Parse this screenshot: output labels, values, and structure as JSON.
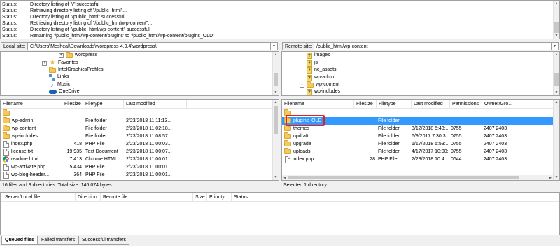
{
  "log": [
    {
      "label": "Status:",
      "text": "Directory listing of \"/\" successful"
    },
    {
      "label": "Status:",
      "text": "Retrieving directory listing of \"/public_html\"..."
    },
    {
      "label": "Status:",
      "text": "Directory listing of \"/public_html\" successful"
    },
    {
      "label": "Status:",
      "text": "Retrieving directory listing of \"/public_html/wp-content\"..."
    },
    {
      "label": "Status:",
      "text": "Directory listing of \"/public_html/wp-content\" successful"
    },
    {
      "label": "Status:",
      "text": "Renaming '/public_html/wp-content/plugins' to '/public_html/wp-content/plugins_OLD'"
    }
  ],
  "local_site": {
    "label": "Local site:",
    "path": "C:\\Users\\Mesheal\\Downloads\\wordpress-4.9.4\\wordpress\\",
    "tree": [
      {
        "label": "wordpress",
        "icon": "folder-icon",
        "expander": "+"
      },
      {
        "label": "Favorites",
        "icon": "star-icon",
        "expander": "+"
      },
      {
        "label": "IntelGraphicsProfiles",
        "icon": "folder-icon",
        "expander": ""
      },
      {
        "label": "Links",
        "icon": "link-icon",
        "expander": ""
      },
      {
        "label": "Music",
        "icon": "music-icon",
        "expander": ""
      },
      {
        "label": "OneDrive",
        "icon": "cloud-icon",
        "expander": ""
      }
    ],
    "columns": {
      "filename": "Filename",
      "filesize": "Filesize",
      "filetype": "Filetype",
      "modified": "Last modified"
    },
    "files": [
      {
        "name": "..",
        "size": "",
        "type": "",
        "modified": "",
        "icon": "folder-icon"
      },
      {
        "name": "wp-admin",
        "size": "",
        "type": "File folder",
        "modified": "2/23/2018 11:11:13...",
        "icon": "folder-icon"
      },
      {
        "name": "wp-content",
        "size": "",
        "type": "File folder",
        "modified": "2/23/2018 11:02:18...",
        "icon": "folder-icon"
      },
      {
        "name": "wp-includes",
        "size": "",
        "type": "File folder",
        "modified": "2/23/2018 11:08:57...",
        "icon": "folder-icon"
      },
      {
        "name": "index.php",
        "size": "418",
        "type": "PHP File",
        "modified": "2/23/2018 11:00:03...",
        "icon": "file-icon"
      },
      {
        "name": "license.txt",
        "size": "19,935",
        "type": "Text Document",
        "modified": "2/23/2018 11:00:07...",
        "icon": "file-icon"
      },
      {
        "name": "readme.html",
        "size": "7,413",
        "type": "Chrome HTML...",
        "modified": "2/23/2018 11:00:01...",
        "icon": "chrome-icon"
      },
      {
        "name": "wp-activate.php",
        "size": "5,434",
        "type": "PHP File",
        "modified": "2/23/2018 11:00:01...",
        "icon": "file-icon"
      },
      {
        "name": "wp-blog-header...",
        "size": "364",
        "type": "PHP File",
        "modified": "2/23/2018 11:00:01...",
        "icon": "file-icon"
      }
    ],
    "status": "16 files and 3 directories. Total size: 146,074 bytes"
  },
  "remote_site": {
    "label": "Remote site:",
    "path": "/public_html/wp-content",
    "tree": [
      {
        "label": "images",
        "icon": "question-icon",
        "expander": ""
      },
      {
        "label": "js",
        "icon": "question-icon",
        "expander": ""
      },
      {
        "label": "nc_assets",
        "icon": "question-icon",
        "expander": ""
      },
      {
        "label": "wp-admin",
        "icon": "question-icon",
        "expander": ""
      },
      {
        "label": "wp-content",
        "icon": "folder-icon",
        "expander": "-"
      },
      {
        "label": "wp-includes",
        "icon": "question-icon",
        "expander": ""
      }
    ],
    "columns": {
      "filename": "Filename",
      "filesize": "Filesize",
      "filetype": "Filetype",
      "modified": "Last modified",
      "permissions": "Permissions",
      "owner": "Owner/Gro..."
    },
    "files": [
      {
        "name": "..",
        "size": "",
        "type": "",
        "modified": "",
        "permissions": "",
        "owner": "",
        "icon": "folder-icon"
      },
      {
        "name": "plugins_OLD",
        "size": "",
        "type": "File folder",
        "modified": "",
        "permissions": "",
        "owner": "",
        "icon": "folder-icon"
      },
      {
        "name": "themes",
        "size": "",
        "type": "File folder",
        "modified": "3/12/2018 5:43:...",
        "permissions": "0755",
        "owner": "2407 2403",
        "icon": "folder-icon"
      },
      {
        "name": "updraft",
        "size": "",
        "type": "File folder",
        "modified": "6/9/2017 7:30:3...",
        "permissions": "0755",
        "owner": "2407 2403",
        "icon": "folder-icon"
      },
      {
        "name": "upgrade",
        "size": "",
        "type": "File folder",
        "modified": "1/17/2018 5:53:...",
        "permissions": "0755",
        "owner": "2407 2403",
        "icon": "folder-icon"
      },
      {
        "name": "uploads",
        "size": "",
        "type": "File folder",
        "modified": "4/17/2017 10:00:...",
        "permissions": "0755",
        "owner": "2407 2403",
        "icon": "folder-icon"
      },
      {
        "name": "index.php",
        "size": "28",
        "type": "PHP File",
        "modified": "2/23/2018 10:4...",
        "permissions": "0644",
        "owner": "2407 2403",
        "icon": "file-icon"
      }
    ],
    "status": "Selected 1 directory."
  },
  "queue": {
    "columns": {
      "server": "Server/Local file",
      "direction": "Direction",
      "remote": "Remote file",
      "size": "Size",
      "priority": "Priority",
      "status": "Status"
    }
  },
  "tabs": [
    "Queued files",
    "Failed transfers",
    "Successful transfers"
  ],
  "colors": {
    "selection": "#3399ff",
    "highlight": "#e02020"
  }
}
